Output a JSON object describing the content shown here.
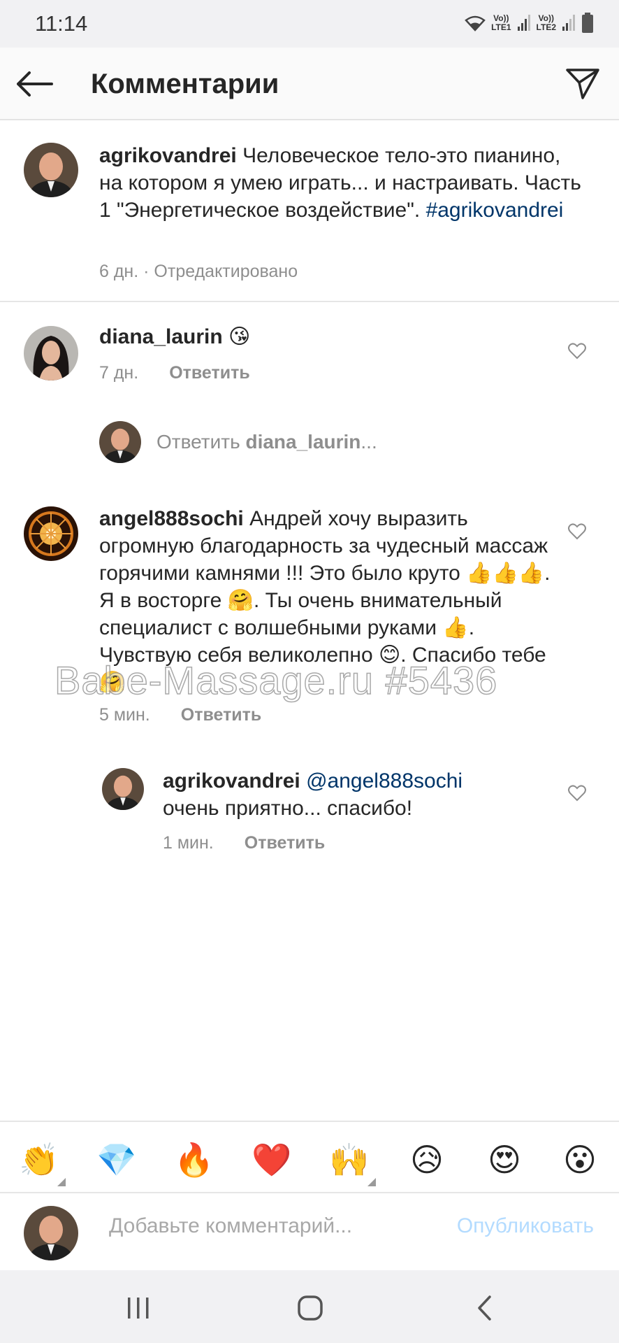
{
  "status": {
    "time": "11:14",
    "sim1": "LTE1",
    "sim2": "LTE2",
    "volte": "Vo))"
  },
  "header": {
    "title": "Комментарии",
    "back_icon": "arrow-left-icon",
    "send_icon": "paper-plane-icon"
  },
  "caption": {
    "username": "agrikovandrei",
    "text_before": " Человеческое тело-это пианино, на котором я умею играть... и настраивать. Часть 1 \"Энергетическое воздействие\". ",
    "hashtag": "#agrikovandrei",
    "time": "6 дн.",
    "edited": "· Отредактировано"
  },
  "comments": [
    {
      "username": "diana_laurin",
      "text": " 😘",
      "time": "7 дн.",
      "reply_label": "Ответить"
    },
    {
      "username": "angel888sochi",
      "text": " Андрей хочу выразить огромную благодарность за чудесный массаж горячими камнями !!! Это было круто 👍👍👍. Я в восторге 🤗. Ты очень внимательный специалист с волшебными руками 👍. Чувствую себя великолепно 😊. Спасибо тебе 🤗",
      "time": "5 мин.",
      "reply_label": "Ответить"
    }
  ],
  "reply_prompt": {
    "prefix": "Ответить ",
    "target": "diana_laurin",
    "suffix": "..."
  },
  "reply": {
    "username": "agrikovandrei",
    "mention": "@angel888sochi",
    "text": "очень приятно... спасибо!",
    "time": "1 мин.",
    "reply_label": "Ответить"
  },
  "watermark": "Babe-Massage.ru #5436",
  "quick_emojis": [
    "👏",
    "💎",
    "🔥",
    "❤️",
    "🙌",
    "😥",
    "😍",
    "😮"
  ],
  "composer": {
    "placeholder": "Добавьте комментарий...",
    "post_label": "Опубликовать"
  }
}
